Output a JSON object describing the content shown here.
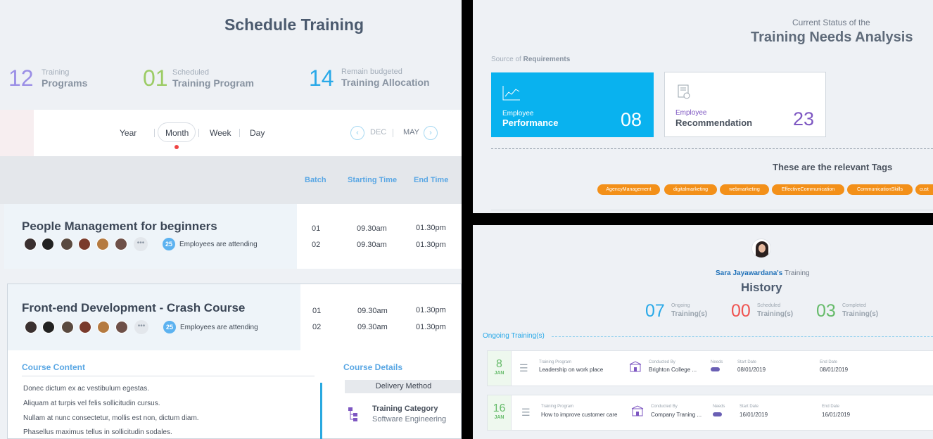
{
  "schedule": {
    "title": "Schedule Training",
    "stats": [
      {
        "num": "12",
        "small": "Training",
        "big": "Programs",
        "color": "#9b8fe6"
      },
      {
        "num": "01",
        "small": "Scheduled",
        "big": "Training Program",
        "color": "#9ccc65"
      },
      {
        "num": "14",
        "small": "Remain budgeted",
        "big": "Training Allocation",
        "color": "#29a9e8"
      }
    ],
    "tabs": [
      "Year",
      "Month",
      "Week",
      "Day"
    ],
    "prev": "DEC",
    "next": "MAY",
    "columns": [
      "Batch",
      "Starting Time",
      "End Time"
    ],
    "courses": [
      {
        "title": "People Management for beginners",
        "count": "25",
        "attending": "Employees are attending",
        "rows": [
          {
            "batch": "01",
            "start": "09.30am",
            "end": "01.30pm"
          },
          {
            "batch": "02",
            "start": "09.30am",
            "end": "01.30pm"
          }
        ]
      },
      {
        "title": "Front-end Development - Crash Course",
        "count": "25",
        "attending": "Employees are attending",
        "rows": [
          {
            "batch": "01",
            "start": "09.30am",
            "end": "01.30pm"
          },
          {
            "batch": "02",
            "start": "09.30am",
            "end": "01.30pm"
          }
        ]
      }
    ],
    "content_title": "Course Content",
    "content_lines": [
      "Donec dictum ex ac vestibulum egestas.",
      "Aliquam at turpis vel felis sollicitudin cursus.",
      "Nullam at nunc consectetur, mollis est non, dictum diam.",
      "Phasellus maximus tellus in sollicitudin sodales."
    ],
    "details_title": "Course Details",
    "delivery": "Delivery Method",
    "category_label": "Training Category",
    "category_value": "Software Engineering",
    "more": "•••"
  },
  "tna": {
    "subtitle": "Current Status of the",
    "title": "Training Needs Analysis",
    "source_pre": "Source of",
    "source_bold": "Requirements",
    "cards": [
      {
        "small": "Employee",
        "big": "Performance",
        "num": "08"
      },
      {
        "small": "Employee",
        "big": "Recommendation",
        "num": "23"
      }
    ],
    "tags_title": "These are the relevant Tags",
    "tags": [
      "AgencyManagement",
      "digitalmarketing",
      "webmarketing",
      "EffectiveCommunication",
      "CommunicationSkills",
      "cust"
    ],
    "accent": "#09b2ef",
    "tag_color": "#f39019"
  },
  "history": {
    "name": "Sara Jayawardana's",
    "name_suffix": "Training",
    "title": "History",
    "stats": [
      {
        "num": "07",
        "small": "Ongoing",
        "big": "Training(s)",
        "color": "#29a9e8"
      },
      {
        "num": "00",
        "small": "Scheduled",
        "big": "Training(s)",
        "color": "#ef5350"
      },
      {
        "num": "03",
        "small": "Completed",
        "big": "Training(s)",
        "color": "#66bb6a"
      }
    ],
    "ongoing_label": "Ongoing Training(s)",
    "rows": [
      {
        "day": "8",
        "month": "JAN",
        "program_label": "Training Program",
        "program": "Leadership on work place",
        "by_label": "Conducted By",
        "by": "Brighton College ...",
        "needs_label": "Needs",
        "start_label": "Start Date",
        "start": "08/01/2019",
        "end_label": "End Date",
        "end": "08/01/2019"
      },
      {
        "day": "16",
        "month": "JAN",
        "program_label": "Training Program",
        "program": "How to improve customer care",
        "by_label": "Conducted By",
        "by": "Company Traning ...",
        "needs_label": "Needs",
        "start_label": "Start Date",
        "start": "16/01/2019",
        "end_label": "End Date",
        "end": "16/01/2019"
      }
    ]
  }
}
